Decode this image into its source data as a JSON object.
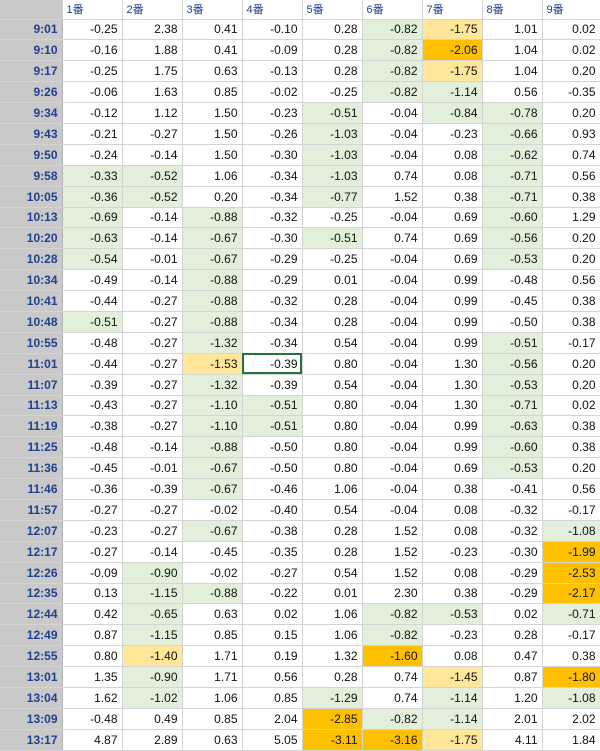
{
  "headers": [
    "",
    "1番",
    "2番",
    "3番",
    "4番",
    "5番",
    "6番",
    "7番",
    "8番",
    "9番"
  ],
  "colors": {
    "green": "#e2efda",
    "yellow": "#ffe699",
    "orange": "#ffc000",
    "time_bg": "#c9c9c9",
    "header_text": "#1f3f8f"
  },
  "selected_cell": {
    "time": "11:01",
    "column": "4番"
  },
  "rows": [
    {
      "time": "9:01",
      "v": [
        "-0.25",
        "2.38",
        "0.41",
        "-0.10",
        "0.28",
        "-0.82",
        "-1.75",
        "1.01",
        "0.02"
      ]
    },
    {
      "time": "9:10",
      "v": [
        "-0.16",
        "1.88",
        "0.41",
        "-0.09",
        "0.28",
        "-0.82",
        "-2.06",
        "1.04",
        "0.02"
      ]
    },
    {
      "time": "9:17",
      "v": [
        "-0.25",
        "1.75",
        "0.63",
        "-0.13",
        "0.28",
        "-0.82",
        "-1.75",
        "1.04",
        "0.20"
      ]
    },
    {
      "time": "9:26",
      "v": [
        "-0.06",
        "1.63",
        "0.85",
        "-0.02",
        "-0.25",
        "-0.82",
        "-1.14",
        "0.56",
        "-0.35"
      ]
    },
    {
      "time": "9:34",
      "v": [
        "-0.12",
        "1.12",
        "1.50",
        "-0.23",
        "-0.51",
        "-0.04",
        "-0.84",
        "-0.78",
        "0.20"
      ]
    },
    {
      "time": "9:43",
      "v": [
        "-0.21",
        "-0.27",
        "1.50",
        "-0.26",
        "-1.03",
        "-0.04",
        "-0.23",
        "-0.66",
        "0.93"
      ]
    },
    {
      "time": "9:50",
      "v": [
        "-0.24",
        "-0.14",
        "1.50",
        "-0.30",
        "-1.03",
        "-0.04",
        "0.08",
        "-0.62",
        "0.74"
      ]
    },
    {
      "time": "9:58",
      "v": [
        "-0.33",
        "-0.52",
        "1.06",
        "-0.34",
        "-1.03",
        "0.74",
        "0.08",
        "-0.71",
        "0.56"
      ]
    },
    {
      "time": "10:05",
      "v": [
        "-0.36",
        "-0.52",
        "0.20",
        "-0.34",
        "-0.77",
        "1.52",
        "0.38",
        "-0.71",
        "0.38"
      ]
    },
    {
      "time": "10:13",
      "v": [
        "-0.69",
        "-0.14",
        "-0.88",
        "-0.32",
        "-0.25",
        "-0.04",
        "0.69",
        "-0.60",
        "1.29"
      ]
    },
    {
      "time": "10:20",
      "v": [
        "-0.63",
        "-0.14",
        "-0.67",
        "-0.30",
        "-0.51",
        "0.74",
        "0.69",
        "-0.56",
        "0.20"
      ]
    },
    {
      "time": "10:28",
      "v": [
        "-0.54",
        "-0.01",
        "-0.67",
        "-0.29",
        "-0.25",
        "-0.04",
        "0.69",
        "-0.53",
        "0.20"
      ]
    },
    {
      "time": "10:34",
      "v": [
        "-0.49",
        "-0.14",
        "-0.88",
        "-0.29",
        "0.01",
        "-0.04",
        "0.99",
        "-0.48",
        "0.56"
      ]
    },
    {
      "time": "10:41",
      "v": [
        "-0.44",
        "-0.27",
        "-0.88",
        "-0.32",
        "0.28",
        "-0.04",
        "0.99",
        "-0.45",
        "0.38"
      ]
    },
    {
      "time": "10:48",
      "v": [
        "-0.51",
        "-0.27",
        "-0.88",
        "-0.34",
        "0.28",
        "-0.04",
        "0.99",
        "-0.50",
        "0.38"
      ]
    },
    {
      "time": "10:55",
      "v": [
        "-0.48",
        "-0.27",
        "-1.32",
        "-0.34",
        "0.54",
        "-0.04",
        "0.99",
        "-0.51",
        "-0.17"
      ]
    },
    {
      "time": "11:01",
      "v": [
        "-0.44",
        "-0.27",
        "-1.53",
        "-0.39",
        "0.80",
        "-0.04",
        "1.30",
        "-0.56",
        "0.20"
      ]
    },
    {
      "time": "11:07",
      "v": [
        "-0.39",
        "-0.27",
        "-1.32",
        "-0.39",
        "0.54",
        "-0.04",
        "1.30",
        "-0.53",
        "0.20"
      ]
    },
    {
      "time": "11:13",
      "v": [
        "-0.43",
        "-0.27",
        "-1.10",
        "-0.51",
        "0.80",
        "-0.04",
        "1.30",
        "-0.71",
        "0.02"
      ]
    },
    {
      "time": "11:19",
      "v": [
        "-0.38",
        "-0.27",
        "-1.10",
        "-0.51",
        "0.80",
        "-0.04",
        "0.99",
        "-0.63",
        "0.38"
      ]
    },
    {
      "time": "11:25",
      "v": [
        "-0.48",
        "-0.14",
        "-0.88",
        "-0.50",
        "0.80",
        "-0.04",
        "0.99",
        "-0.60",
        "0.38"
      ]
    },
    {
      "time": "11:36",
      "v": [
        "-0.45",
        "-0.01",
        "-0.67",
        "-0.50",
        "0.80",
        "-0.04",
        "0.69",
        "-0.53",
        "0.20"
      ]
    },
    {
      "time": "11:46",
      "v": [
        "-0.36",
        "-0.39",
        "-0.67",
        "-0.46",
        "1.06",
        "-0.04",
        "0.38",
        "-0.41",
        "0.56"
      ]
    },
    {
      "time": "11:57",
      "v": [
        "-0.27",
        "-0.27",
        "-0.02",
        "-0.40",
        "0.54",
        "-0.04",
        "0.08",
        "-0.32",
        "-0.17"
      ]
    },
    {
      "time": "12:07",
      "v": [
        "-0.23",
        "-0.27",
        "-0.67",
        "-0.38",
        "0.28",
        "1.52",
        "0.08",
        "-0.32",
        "-1.08"
      ]
    },
    {
      "time": "12:17",
      "v": [
        "-0.27",
        "-0.14",
        "-0.45",
        "-0.35",
        "0.28",
        "1.52",
        "-0.23",
        "-0.30",
        "-1.99"
      ]
    },
    {
      "time": "12:26",
      "v": [
        "-0.09",
        "-0.90",
        "-0.02",
        "-0.27",
        "0.54",
        "1.52",
        "0.08",
        "-0.29",
        "-2.53"
      ]
    },
    {
      "time": "12:35",
      "v": [
        "0.13",
        "-1.15",
        "-0.88",
        "-0.22",
        "0.01",
        "2.30",
        "0.38",
        "-0.29",
        "-2.17"
      ]
    },
    {
      "time": "12:44",
      "v": [
        "0.42",
        "-0.65",
        "0.63",
        "0.02",
        "1.06",
        "-0.82",
        "-0.53",
        "0.02",
        "-0.71"
      ]
    },
    {
      "time": "12:49",
      "v": [
        "0.87",
        "-1.15",
        "0.85",
        "0.15",
        "1.06",
        "-0.82",
        "-0.23",
        "0.28",
        "-0.17"
      ]
    },
    {
      "time": "12:55",
      "v": [
        "0.80",
        "-1.40",
        "1.71",
        "0.19",
        "1.32",
        "-1.60",
        "0.08",
        "0.47",
        "0.38"
      ]
    },
    {
      "time": "13:01",
      "v": [
        "1.35",
        "-0.90",
        "1.71",
        "0.56",
        "0.28",
        "0.74",
        "-1.45",
        "0.87",
        "-1.80"
      ]
    },
    {
      "time": "13:04",
      "v": [
        "1.62",
        "-1.02",
        "1.06",
        "0.85",
        "-1.29",
        "0.74",
        "-1.14",
        "1.20",
        "-1.08"
      ]
    },
    {
      "time": "13:09",
      "v": [
        "-0.48",
        "0.49",
        "0.85",
        "2.04",
        "-2.85",
        "-0.82",
        "-1.14",
        "2.01",
        "2.02"
      ]
    },
    {
      "time": "13:17",
      "v": [
        "4.87",
        "2.89",
        "0.63",
        "5.05",
        "-3.11",
        "-3.16",
        "-1.75",
        "4.11",
        "1.84"
      ]
    }
  ]
}
